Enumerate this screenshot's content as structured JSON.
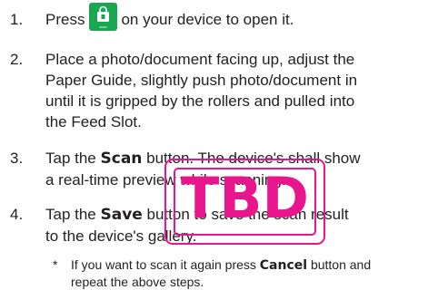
{
  "steps": [
    {
      "num": "1.",
      "before": "Press",
      "after": "on your device to open it."
    },
    {
      "num": "2.",
      "lines": [
        "Place a photo/document facing up, adjust the",
        "Paper Guide, slightly push photo/document in",
        "until it is gripped by the rollers and pulled into",
        "the Feed Slot."
      ]
    },
    {
      "num": "3.",
      "pre": "Tap the ",
      "bold": "Scan",
      "post": " button. The device's shall show",
      "line2": "a real-time preview while scanning."
    },
    {
      "num": "4.",
      "pre": "Tap the ",
      "bold": "Save",
      "post": " button to save the scan result",
      "line2": "to the device's gallery."
    }
  ],
  "note": {
    "star": "*",
    "pre": "If you want to scan it again press ",
    "bold": "Cancel",
    "post": " button and",
    "line2": "repeat the above steps."
  },
  "stamp": {
    "text": "TBD",
    "color": "#e8168c"
  },
  "app_icon": {
    "name": "shopping-bag-icon",
    "color": "#1aa751",
    "label": "scan"
  }
}
